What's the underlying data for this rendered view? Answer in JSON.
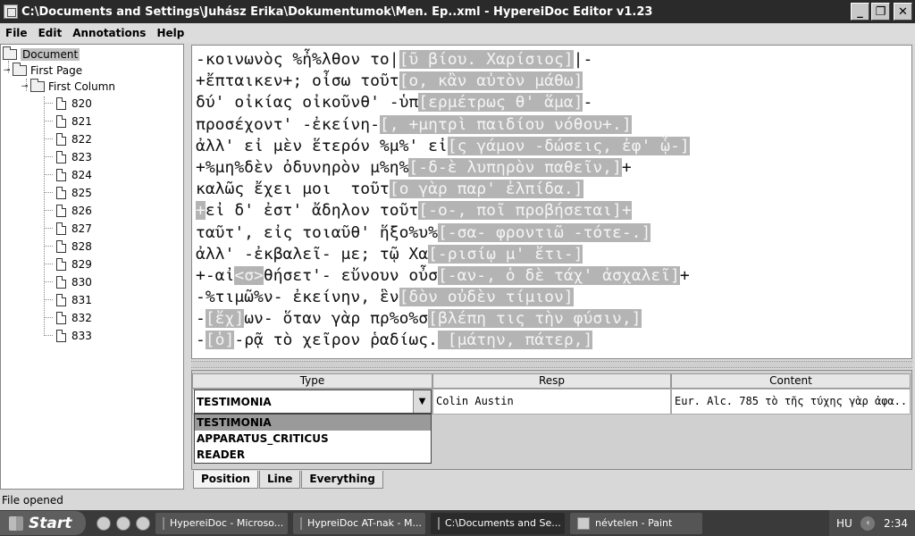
{
  "window": {
    "title": "C:\\Documents and Settings\\Juhász Erika\\Dokumentumok\\Men. Ep..xml - HypereiDoc Editor v1.23",
    "minimize": "_",
    "maximize": "❐",
    "close": "✕"
  },
  "menu": [
    "File",
    "Edit",
    "Annotations",
    "Help"
  ],
  "tree": {
    "root": "Document",
    "page": "First Page",
    "column": "First Column",
    "lines": [
      "820",
      "821",
      "822",
      "823",
      "824",
      "825",
      "826",
      "827",
      "828",
      "829",
      "830",
      "831",
      "832",
      "833"
    ]
  },
  "editor": {
    "lines": [
      [
        {
          "t": "-κοινωνὸς %ἦ%λθον το|",
          "h": false
        },
        {
          "t": "[ῦ βίου. Χαρίσιος]",
          "h": true
        },
        {
          "t": "|-",
          "h": false
        }
      ],
      [
        {
          "t": "+ἔπταικεν+; οἶσω τοῦτ",
          "h": false
        },
        {
          "t": "[ο, κἂν αὐτὸν μάθω]",
          "h": true
        }
      ],
      [
        {
          "t": "δύ' οἰκίας οἰκοῦνθ' -ὑπ",
          "h": false
        },
        {
          "t": "[ερμέτρως θ' ἅμα]",
          "h": true
        },
        {
          "t": "-",
          "h": false
        }
      ],
      [
        {
          "t": "προσέχοντ' -ἐκείνη-",
          "h": false
        },
        {
          "t": "[, +μητρὶ παιδίου νόθου+.]",
          "h": true
        }
      ],
      [
        {
          "t": "ἀλλ' εἰ μὲν ἕτερόν %μ%' εἰ",
          "h": false
        },
        {
          "t": "[ς γάμον -δώσεις, ἐφ' ᾧ-]",
          "h": true
        }
      ],
      [
        {
          "t": "+%μη%δὲν ὀδυνηρὸν μ%η%",
          "h": false
        },
        {
          "t": "[-δ-ὲ λυπηρὸν παθεῖν,]",
          "h": true
        },
        {
          "t": "+",
          "h": false
        }
      ],
      [
        {
          "t": "καλῶς ἔχει μοι  τοῦτ",
          "h": false
        },
        {
          "t": "[ο γὰρ παρ' ἐλπίδα.]",
          "h": true
        }
      ],
      [
        {
          "t": "+",
          "h": true
        },
        {
          "t": "εἰ δ' ἐστ' ἄδηλον τοῦτ",
          "h": false
        },
        {
          "t": "[-ο-, ποῖ προβήσεται]+",
          "h": true
        }
      ],
      [
        {
          "t": "ταῦτ', εἰς τοιαῦθ' ἥξο%υ%",
          "h": false
        },
        {
          "t": "[-σα- φροντιῶ -τότε-.]",
          "h": true
        }
      ],
      [
        {
          "t": "ἀλλ' -ἐκβαλεῖ- με; τῷ Χα",
          "h": false
        },
        {
          "t": "[-ρισίῳ μ' ἔτι-]",
          "h": true
        }
      ],
      [
        {
          "t": "+-αἰ",
          "h": false
        },
        {
          "t": "<σ>",
          "h": true
        },
        {
          "t": "θήσετ'- εὔνουν οὖσ",
          "h": false
        },
        {
          "t": "[-αν-, ὁ δὲ τάχ' ἀσχαλεῖ]",
          "h": true
        },
        {
          "t": "+",
          "h": false
        }
      ],
      [
        {
          "t": "-%τιμῶ%ν- ἐκείνην, ἓν",
          "h": false
        },
        {
          "t": "[δὸν οὐδὲν τίμιον]",
          "h": true
        }
      ],
      [
        {
          "t": "-",
          "h": false
        },
        {
          "t": "[ἔχ]",
          "h": true
        },
        {
          "t": "ων- ὅταν γὰρ πρ%ο%σ",
          "h": false
        },
        {
          "t": "[βλέπη τις τὴν φύσιν,]",
          "h": true
        }
      ],
      [
        {
          "t": "-",
          "h": false
        },
        {
          "t": "[ὁ]",
          "h": true
        },
        {
          "t": "-ρᾷ τὸ χεῖρον ῥαδίως.",
          "h": false
        },
        {
          "t": " [μάτην, πάτερ,]",
          "h": true
        }
      ]
    ]
  },
  "table": {
    "headers": [
      "Type",
      "Resp",
      "Content"
    ],
    "row": {
      "type": "TESTIMONIA",
      "resp": "Colin Austin",
      "content": "Eur. Alc. 785 τὸ τῆς τύχης γὰρ ἀφα..."
    },
    "options": [
      "TESTIMONIA",
      "APPARATUS_CRITICUS",
      "READER"
    ],
    "selected_option": "TESTIMONIA"
  },
  "tabs": [
    "Position",
    "Line",
    "Everything"
  ],
  "active_tab": "Position",
  "status": "File opened",
  "taskbar": {
    "start": "Start",
    "tasks": [
      "HypereiDoc - Microso...",
      "HypreiDoc AT-nak - M...",
      "C:\\Documents and Se...",
      "névtelen - Paint"
    ],
    "active_task": 2,
    "lang": "HU",
    "clock": "2:34"
  }
}
